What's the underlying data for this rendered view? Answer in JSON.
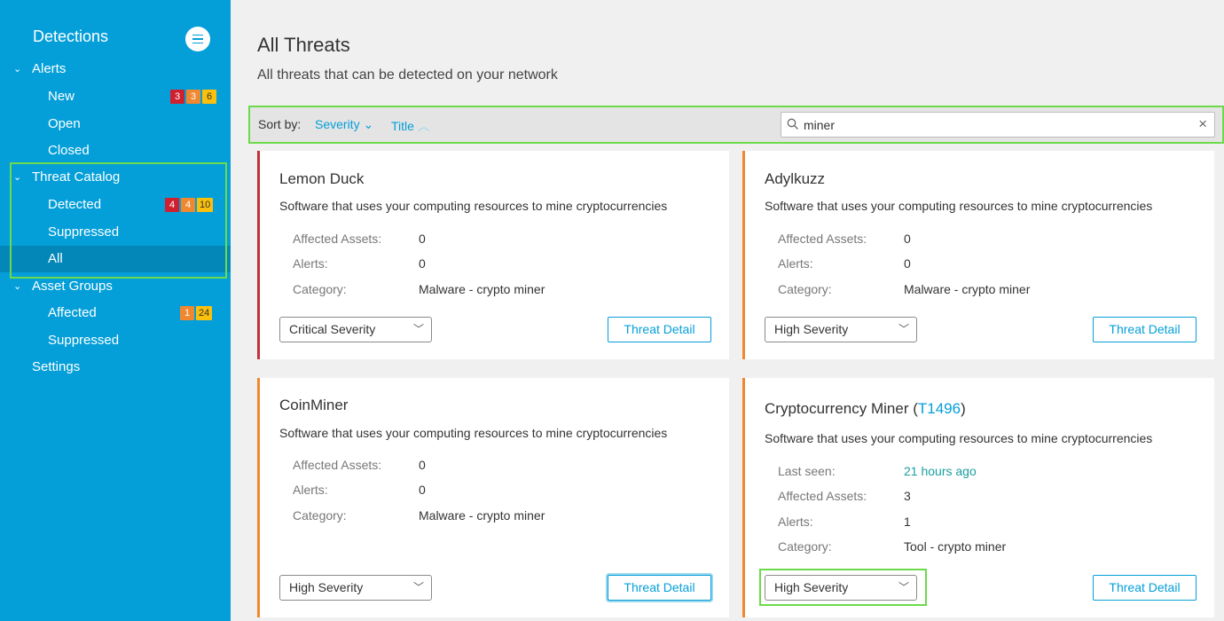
{
  "sidebar": {
    "title": "Detections",
    "items": [
      {
        "label": "Alerts",
        "level": 0,
        "chevron": "⌄"
      },
      {
        "label": "New",
        "level": 1,
        "badges": [
          {
            "text": "3",
            "color": "red"
          },
          {
            "text": "3",
            "color": "orange"
          },
          {
            "text": "6",
            "color": "yellow"
          }
        ]
      },
      {
        "label": "Open",
        "level": 1
      },
      {
        "label": "Closed",
        "level": 1
      },
      {
        "label": "Threat Catalog",
        "level": 0,
        "chevron": "⌄"
      },
      {
        "label": "Detected",
        "level": 1,
        "badges": [
          {
            "text": "4",
            "color": "red"
          },
          {
            "text": "4",
            "color": "orange"
          },
          {
            "text": "10",
            "color": "yellow"
          }
        ]
      },
      {
        "label": "Suppressed",
        "level": 1
      },
      {
        "label": "All",
        "level": 1,
        "selected": true
      },
      {
        "label": "Asset Groups",
        "level": 0,
        "chevron": "⌄"
      },
      {
        "label": "Affected",
        "level": 1,
        "badges": [
          {
            "text": "1",
            "color": "orange"
          },
          {
            "text": "24",
            "color": "yellow"
          }
        ]
      },
      {
        "label": "Suppressed",
        "level": 1
      },
      {
        "label": "Settings",
        "level": 0
      }
    ]
  },
  "main": {
    "title": "All Threats",
    "subtitle": "All threats that can be detected on your network",
    "sort": {
      "label": "Sort by:",
      "severity": "Severity",
      "severity_caret": "⌄",
      "title": "Title",
      "title_caret": "︿"
    },
    "search": {
      "value": "miner",
      "placeholder": "",
      "clear": "×"
    },
    "cards": [
      {
        "title": "Lemon Duck",
        "description": "Software that uses your computing resources to mine cryptocurrencies",
        "rows": [
          {
            "label": "Affected Assets:",
            "value": "0"
          },
          {
            "label": "Alerts:",
            "value": "0"
          },
          {
            "label": "Category:",
            "value": "Malware - crypto miner"
          }
        ],
        "severity": "Critical Severity",
        "button": "Threat Detail"
      },
      {
        "title": "Adylkuzz",
        "description": "Software that uses your computing resources to mine cryptocurrencies",
        "rows": [
          {
            "label": "Affected Assets:",
            "value": "0"
          },
          {
            "label": "Alerts:",
            "value": "0"
          },
          {
            "label": "Category:",
            "value": "Malware - crypto miner"
          }
        ],
        "severity": "High Severity",
        "button": "Threat Detail"
      },
      {
        "title": "CoinMiner",
        "description": "Software that uses your computing resources to mine cryptocurrencies",
        "rows": [
          {
            "label": "Affected Assets:",
            "value": "0"
          },
          {
            "label": "Alerts:",
            "value": "0"
          },
          {
            "label": "Category:",
            "value": "Malware - crypto miner"
          }
        ],
        "severity": "High Severity",
        "button": "Threat Detail"
      },
      {
        "title": "Cryptocurrency Miner (",
        "title_link": "T1496",
        "title_suffix": ")",
        "description": "Software that uses your computing resources to mine cryptocurrencies",
        "rows": [
          {
            "label": "Last seen:",
            "value": "21 hours ago"
          },
          {
            "label": "Affected Assets:",
            "value": "3"
          },
          {
            "label": "Alerts:",
            "value": "1"
          },
          {
            "label": "Category:",
            "value": "Tool - crypto miner"
          }
        ],
        "severity": "High Severity",
        "button": "Threat Detail"
      }
    ]
  },
  "colors": {
    "sidebar": "#049fd9",
    "accent": "#049fd9",
    "critical": "#c2313a",
    "high": "#f0882f",
    "highlight": "#6cda4a",
    "teal": "#1a9f9f"
  },
  "icons": {
    "menu": "hamburger-icon",
    "search": "search-icon",
    "clear": "close-icon",
    "dropdown": "chevron-down-icon"
  }
}
